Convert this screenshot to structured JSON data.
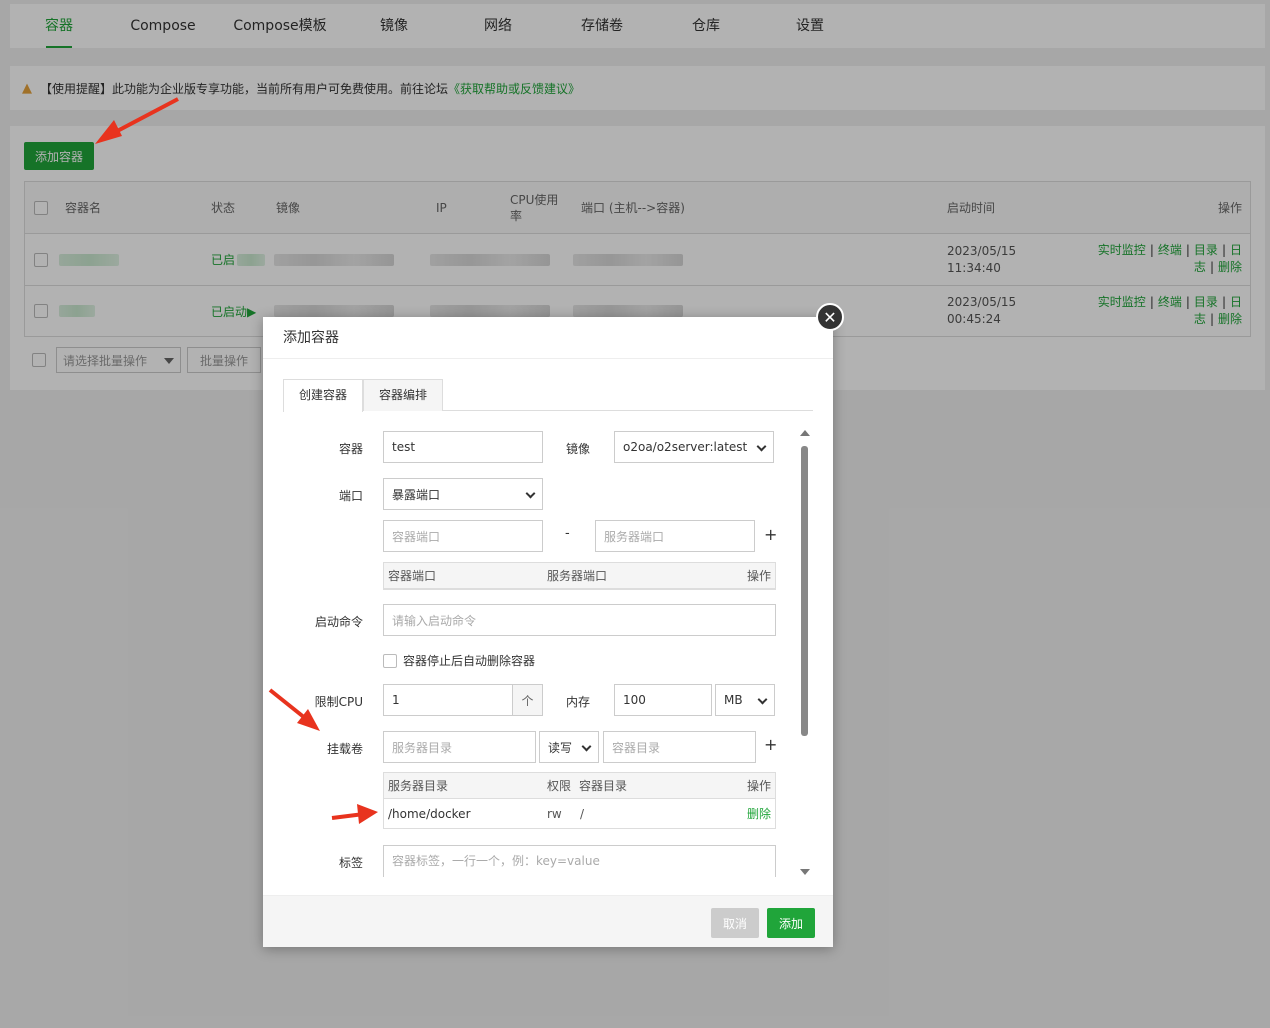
{
  "nav": {
    "tabs": [
      "容器",
      "Compose",
      "Compose模板",
      "镜像",
      "网络",
      "存储卷",
      "仓库",
      "设置"
    ]
  },
  "notice": {
    "prefix": "【使用提醒】此功能为企业版专享功能，当前所有用户可免费使用。前往论坛",
    "link": "《获取帮助或反馈建议》"
  },
  "list": {
    "add_label": "添加容器",
    "headers": {
      "name": "容器名",
      "status": "状态",
      "image": "镜像",
      "ip": "IP",
      "cpu": "CPU使用率",
      "ports": "端口 (主机-->容器)",
      "start_time": "启动时间",
      "ops": "操作"
    },
    "rows": [
      {
        "status": "已启",
        "start_date": "2023/05/15",
        "start_clock": "11:34:40"
      },
      {
        "status": "已启动▶",
        "start_date": "2023/05/15",
        "start_clock": "00:45:24"
      }
    ],
    "row_actions": {
      "monitor": "实时监控",
      "terminal": "终端",
      "dir": "目录",
      "log_a": "日",
      "log_b": "志",
      "delete": "删除"
    },
    "batch_placeholder": "请选择批量操作",
    "batch_button": "批量操作"
  },
  "dialog": {
    "title": "添加容器",
    "close": "✕",
    "tabs": [
      "创建容器",
      "容器编排"
    ],
    "labels": {
      "container": "容器",
      "image": "镜像",
      "port": "端口",
      "command": "启动命令",
      "cpu": "限制CPU",
      "memory": "内存",
      "volume": "挂载卷",
      "tag": "标签"
    },
    "values": {
      "container_name": "test",
      "image": "o2oa/o2server:latest",
      "port_mode": "暴露端口",
      "cpu": "1",
      "cpu_step": "个",
      "memory": "100",
      "memory_unit": "MB",
      "volume_mode": "读写"
    },
    "placeholders": {
      "container_port": "容器端口",
      "server_port": "服务器端口",
      "command": "请输入启动命令",
      "server_dir": "服务器目录",
      "container_dir": "容器目录",
      "tags": "容器标签，一行一个，例：key=value"
    },
    "port_dash": "-",
    "plus": "+",
    "port_table": {
      "headers": [
        "容器端口",
        "服务器端口",
        "操作"
      ]
    },
    "auto_remove": "容器停止后自动删除容器",
    "volume_table": {
      "headers": [
        "服务器目录",
        "权限",
        "容器目录",
        "操作"
      ],
      "rows": [
        {
          "server_dir": "/home/docker",
          "perm": "rw",
          "container_dir": "/",
          "action": "删除"
        }
      ]
    },
    "cancel": "取消",
    "submit": "添加"
  },
  "colors": {
    "accent": "#20a53a",
    "annotation_arrow": "#e8331e",
    "warning": "#e6a23c"
  }
}
